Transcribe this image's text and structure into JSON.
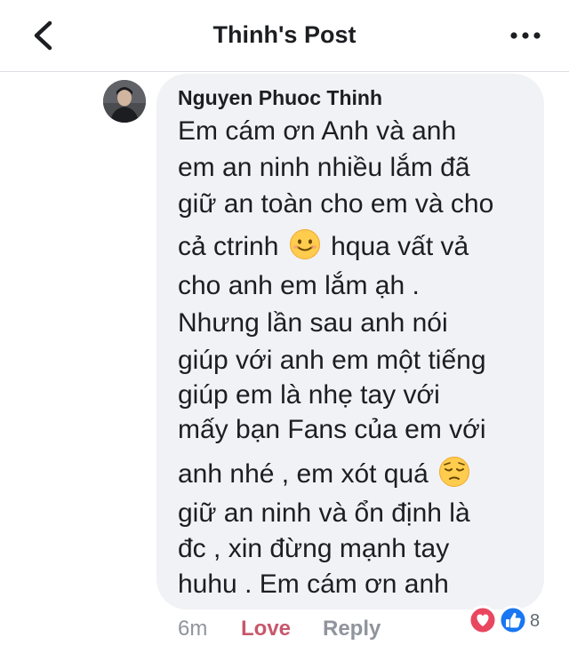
{
  "header": {
    "title": "Thinh's Post",
    "back_icon": "chevron-left-icon",
    "more_icon": "more-horizontal-icon"
  },
  "comment": {
    "author": "Nguyen Phuoc Thinh",
    "lines": [
      "Em cám ơn Anh và anh",
      "em an ninh nhiều lắm đã",
      "giữ an toàn cho em và cho",
      "cả ctrinh",
      "hqua vất vả",
      "cho anh em lắm ạh .",
      "Nhưng lần sau anh nói",
      "giúp với anh em một tiếng",
      "giúp em là nhẹ tay với",
      "mấy bạn Fans của em với",
      "anh nhé , em xót quá",
      "giữ an ninh và ổn định là",
      "đc , xin đừng mạnh tay",
      "huhu . Em cám ơn anh"
    ],
    "emoji_1": "smiling-face-icon",
    "emoji_2": "pensive-face-icon",
    "time": "6m",
    "love_label": "Love",
    "reply_label": "Reply",
    "reaction_count": "8",
    "reaction_icons": [
      "heart-reaction-icon",
      "like-reaction-icon"
    ],
    "colors": {
      "love": "#c8576b",
      "bubble": "#f1f2f5",
      "like": "#1877f2",
      "heart": "#e8475f"
    }
  }
}
